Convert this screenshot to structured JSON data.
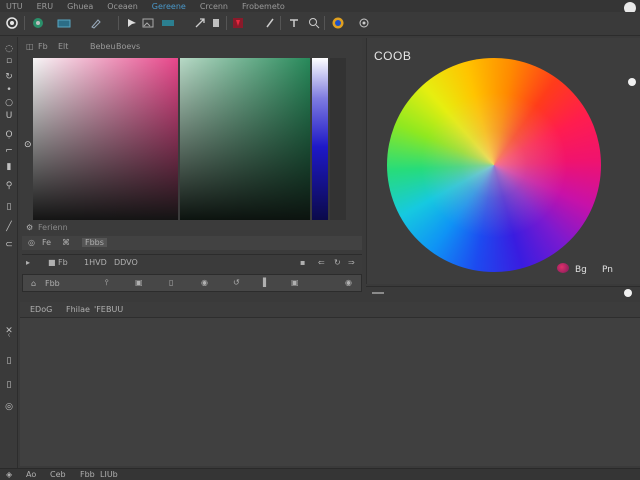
{
  "menu": [
    {
      "label": "UTU",
      "accent": false
    },
    {
      "label": "ERU",
      "accent": false
    },
    {
      "label": "Ghuea",
      "accent": false
    },
    {
      "label": "Oceaen",
      "accent": false
    },
    {
      "label": "Gereene",
      "accent": true
    },
    {
      "label": "Crcenn",
      "accent": false
    },
    {
      "label": "Frobemeto",
      "accent": false
    }
  ],
  "left_panel": {
    "tabs": [
      "Fb",
      "Elt",
      "Bebeu",
      "Boevs"
    ],
    "row1_label": "Ferienn",
    "row2_labels": [
      "Fe",
      "Fbbs"
    ],
    "row3_labels": [
      "Fb",
      "1HVD",
      "DDVO"
    ]
  },
  "tool_row_label": "Fbb",
  "right_panel": {
    "title": "COOB",
    "label_a": "Bg",
    "label_b": "Pn"
  },
  "bottom_panel": {
    "tabs": [
      "EDoG",
      "Fhilae",
      "'FE",
      "BUU"
    ]
  },
  "status_bar": {
    "items": [
      "Ao",
      "Ceb",
      "Fbb",
      "LIUb"
    ]
  },
  "colors": {
    "accent": "#4a98c9",
    "background": "#3a3a3a",
    "hue_red": "#e8468a",
    "hue_green": "#27895a",
    "hue_blue": "#1e18c8"
  }
}
